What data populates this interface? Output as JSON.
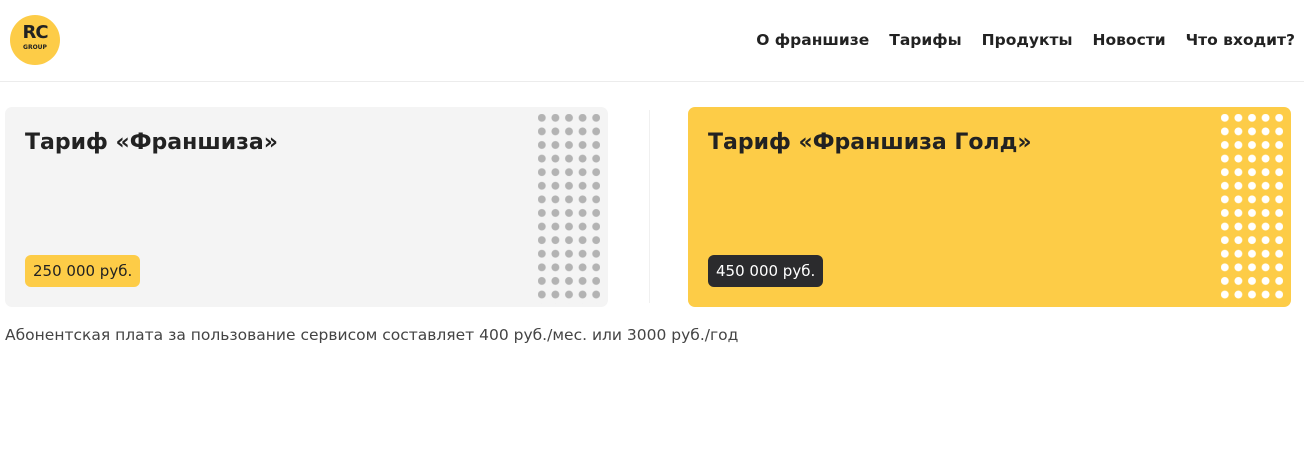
{
  "header": {
    "logo": {
      "main": "RC",
      "sub": "GROUP"
    },
    "nav": [
      "О франшизе",
      "Тарифы",
      "Продукты",
      "Новости",
      "Что входит?"
    ]
  },
  "tariffs": [
    {
      "title": "Тариф «Франшиза»",
      "price": "250 000 руб."
    },
    {
      "title": "Тариф «Франшиза Голд»",
      "price": "450 000 руб."
    }
  ],
  "note": "Абонентская плата за пользование сервисом составляет 400 руб./мес. или 3000 руб./год",
  "colors": {
    "accent_yellow": "#fdcc47",
    "card_gray": "#f4f4f4",
    "badge_dark": "#2b2b2d",
    "text": "#222222"
  }
}
